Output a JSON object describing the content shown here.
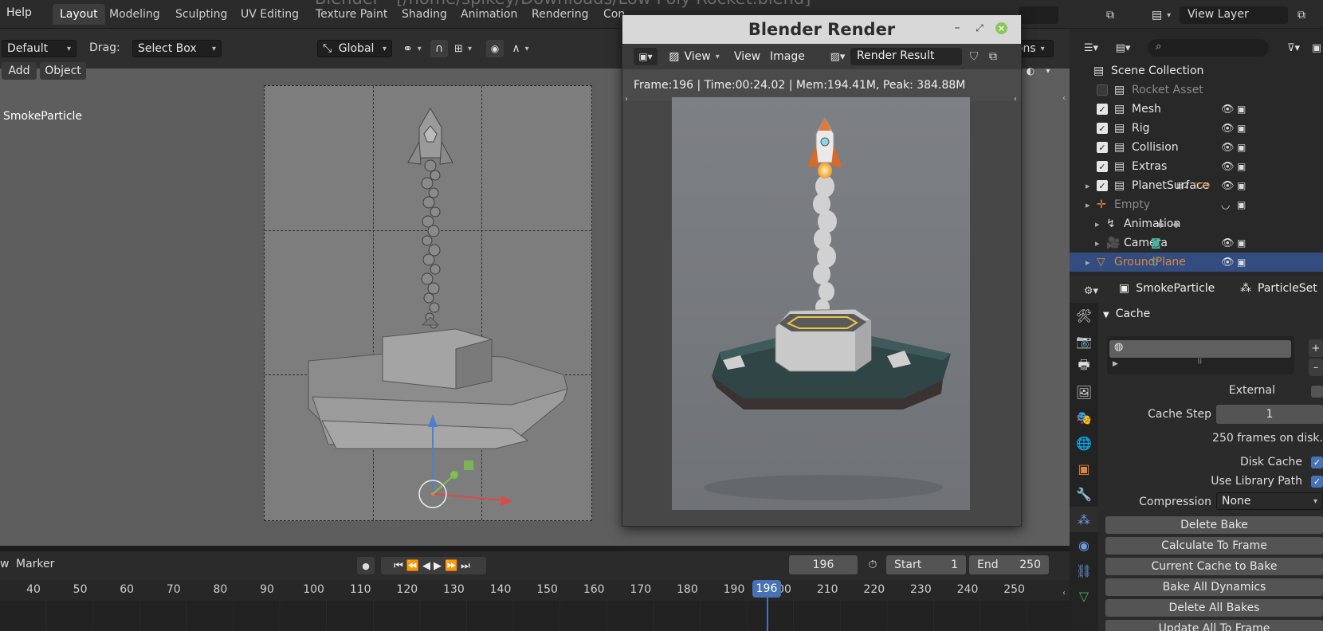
{
  "window_title": "Blender - [/home/spikey/Downloads/Low Poly Rocket.blend]",
  "menu": {
    "help": "Help"
  },
  "workspaces": [
    "Layout",
    "Modeling",
    "Sculpting",
    "UV Editing",
    "Texture Paint",
    "Shading",
    "Animation",
    "Rendering",
    "Con"
  ],
  "topright": {
    "view_layer": "View Layer"
  },
  "header": {
    "mode": "Default",
    "drag_label": "Drag:",
    "drag_value": "Select Box",
    "orientation": "Global",
    "add": "Add",
    "object": "Object"
  },
  "viewport": {
    "active_object": "SmokeParticle",
    "overlay_text": "ions"
  },
  "render_window": {
    "title": "Blender Render",
    "view1": "View",
    "view2": "View",
    "image": "Image",
    "slot": "Render Result",
    "info": "Frame:196 | Time:00:24.02 | Mem:194.41M, Peak: 384.88M"
  },
  "timeline": {
    "view": "w",
    "marker": "Marker",
    "current_frame": "196",
    "start_label": "Start",
    "start": "1",
    "end_label": "End",
    "end": "250",
    "ticks": [
      "40",
      "50",
      "60",
      "70",
      "80",
      "90",
      "100",
      "110",
      "120",
      "130",
      "140",
      "150",
      "160",
      "170",
      "180",
      "190",
      "200",
      "210",
      "220",
      "230",
      "240",
      "250"
    ],
    "playhead": "196"
  },
  "outliner": {
    "rows": [
      {
        "name": "Scene Collection",
        "kind": "scene"
      },
      {
        "name": "Rocket Asset",
        "kind": "collection",
        "checked": false,
        "dim": true
      },
      {
        "name": "Mesh",
        "kind": "collection",
        "checked": true
      },
      {
        "name": "Rig",
        "kind": "collection",
        "checked": true
      },
      {
        "name": "Collision",
        "kind": "collection",
        "checked": true
      },
      {
        "name": "Extras",
        "kind": "collection",
        "checked": true
      },
      {
        "name": "PlanetSurface",
        "kind": "collection",
        "checked": true,
        "badge1": "2",
        "badge2": "29"
      },
      {
        "name": "Empty",
        "kind": "empty",
        "dim": true
      },
      {
        "name": "Animation",
        "kind": "action"
      },
      {
        "name": "Camera",
        "kind": "camera"
      },
      {
        "name": "GroundPlane",
        "kind": "mesh",
        "selected": true
      }
    ]
  },
  "properties": {
    "object": "SmokeParticle",
    "particle_settings": "ParticleSet",
    "panel": "Cache",
    "external": "External",
    "cache_step_label": "Cache Step",
    "cache_step": "1",
    "frames_on_disk": "250 frames on disk.",
    "disk_cache": "Disk Cache",
    "use_library_path": "Use Library Path",
    "compression_label": "Compression",
    "compression": "None",
    "buttons": [
      "Delete Bake",
      "Calculate To Frame",
      "Current Cache to Bake",
      "Bake All Dynamics",
      "Delete All Bakes",
      "Update All To Frame"
    ]
  },
  "colors": {
    "accent": "#4772b3",
    "selected_object": "#e0843a",
    "playhead": "#4772b3"
  }
}
